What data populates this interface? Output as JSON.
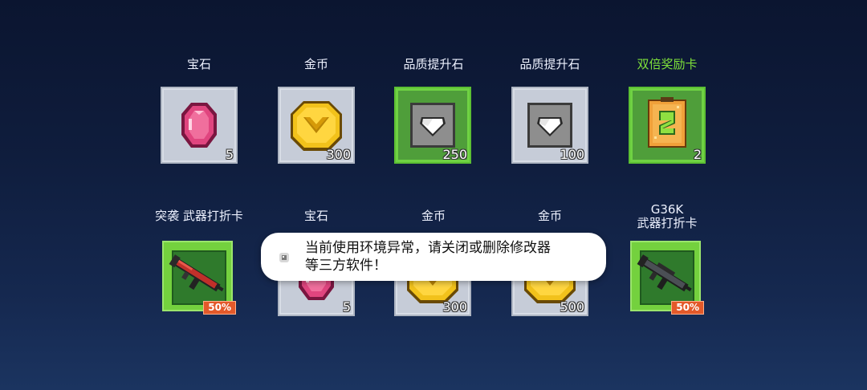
{
  "rows": [
    {
      "items": [
        {
          "label": "宝石",
          "qty": "5",
          "icon": "pink-gem-icon"
        },
        {
          "label": "金币",
          "qty": "300",
          "icon": "gold-coin-icon"
        },
        {
          "label": "品质提升石",
          "qty": "250",
          "icon": "quality-stone-icon",
          "highlight": true
        },
        {
          "label": "品质提升石",
          "qty": "100",
          "icon": "quality-stone-icon"
        },
        {
          "label": "双倍奖励卡",
          "qty": "2",
          "icon": "double-reward-card-icon",
          "highlight": true,
          "label_color": "#7ee03a"
        }
      ]
    },
    {
      "items": [
        {
          "label": "突袭 武器打折卡",
          "discount": "50%",
          "icon": "assault-rifle-icon"
        },
        {
          "label": "宝石",
          "qty": "5",
          "icon": "pink-gem-icon"
        },
        {
          "label": "金币",
          "qty": "300",
          "icon": "gold-coin-icon"
        },
        {
          "label": "金币",
          "qty": "500",
          "icon": "gold-coin-icon"
        },
        {
          "label_line1": "G36K",
          "label_line2": "武器打折卡",
          "discount": "50%",
          "icon": "g36k-rifle-icon"
        }
      ]
    }
  ],
  "toast": {
    "line1": "当前使用环境异常，请关闭或删除修改器",
    "line2": "等三方软件！",
    "icon": "app-icon"
  },
  "colors": {
    "background_top": "#0b1530",
    "background_bottom": "#1b3460",
    "highlight_green": "#7ee03a",
    "discount_orange": "#e3592a"
  }
}
